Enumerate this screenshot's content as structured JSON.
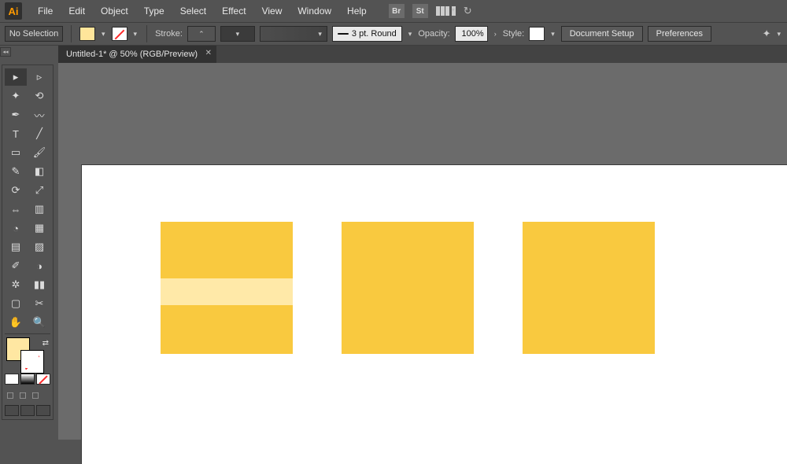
{
  "menubar": {
    "app_abbrev": "Ai",
    "items": [
      "File",
      "Edit",
      "Object",
      "Type",
      "Select",
      "Effect",
      "View",
      "Window",
      "Help"
    ],
    "bridge_label": "Br",
    "stock_label": "St"
  },
  "controlbar": {
    "selection_label": "No Selection",
    "stroke_label": "Stroke:",
    "stroke_preset": "3 pt. Round",
    "opacity_label": "Opacity:",
    "opacity_value": "100%",
    "style_label": "Style:",
    "doc_setup": "Document Setup",
    "preferences": "Preferences"
  },
  "tabs": {
    "doc_title": "Untitled-1* @ 50% (RGB/Preview)"
  },
  "colors": {
    "square_fill": "#f9c93f",
    "stripe_fill": "#ffe9a8"
  },
  "tools": {
    "names": [
      "selection-tool",
      "direct-selection-tool",
      "magic-wand-tool",
      "lasso-tool",
      "pen-tool",
      "curvature-tool",
      "type-tool",
      "line-segment-tool",
      "rectangle-tool",
      "paintbrush-tool",
      "shaper-tool",
      "eraser-tool",
      "rotate-tool",
      "scale-tool",
      "width-tool",
      "free-transform-tool",
      "shape-builder-tool",
      "perspective-grid-tool",
      "mesh-tool",
      "gradient-tool",
      "eyedropper-tool",
      "blend-tool",
      "symbol-sprayer-tool",
      "column-graph-tool",
      "artboard-tool",
      "slice-tool",
      "hand-tool",
      "zoom-tool"
    ]
  }
}
